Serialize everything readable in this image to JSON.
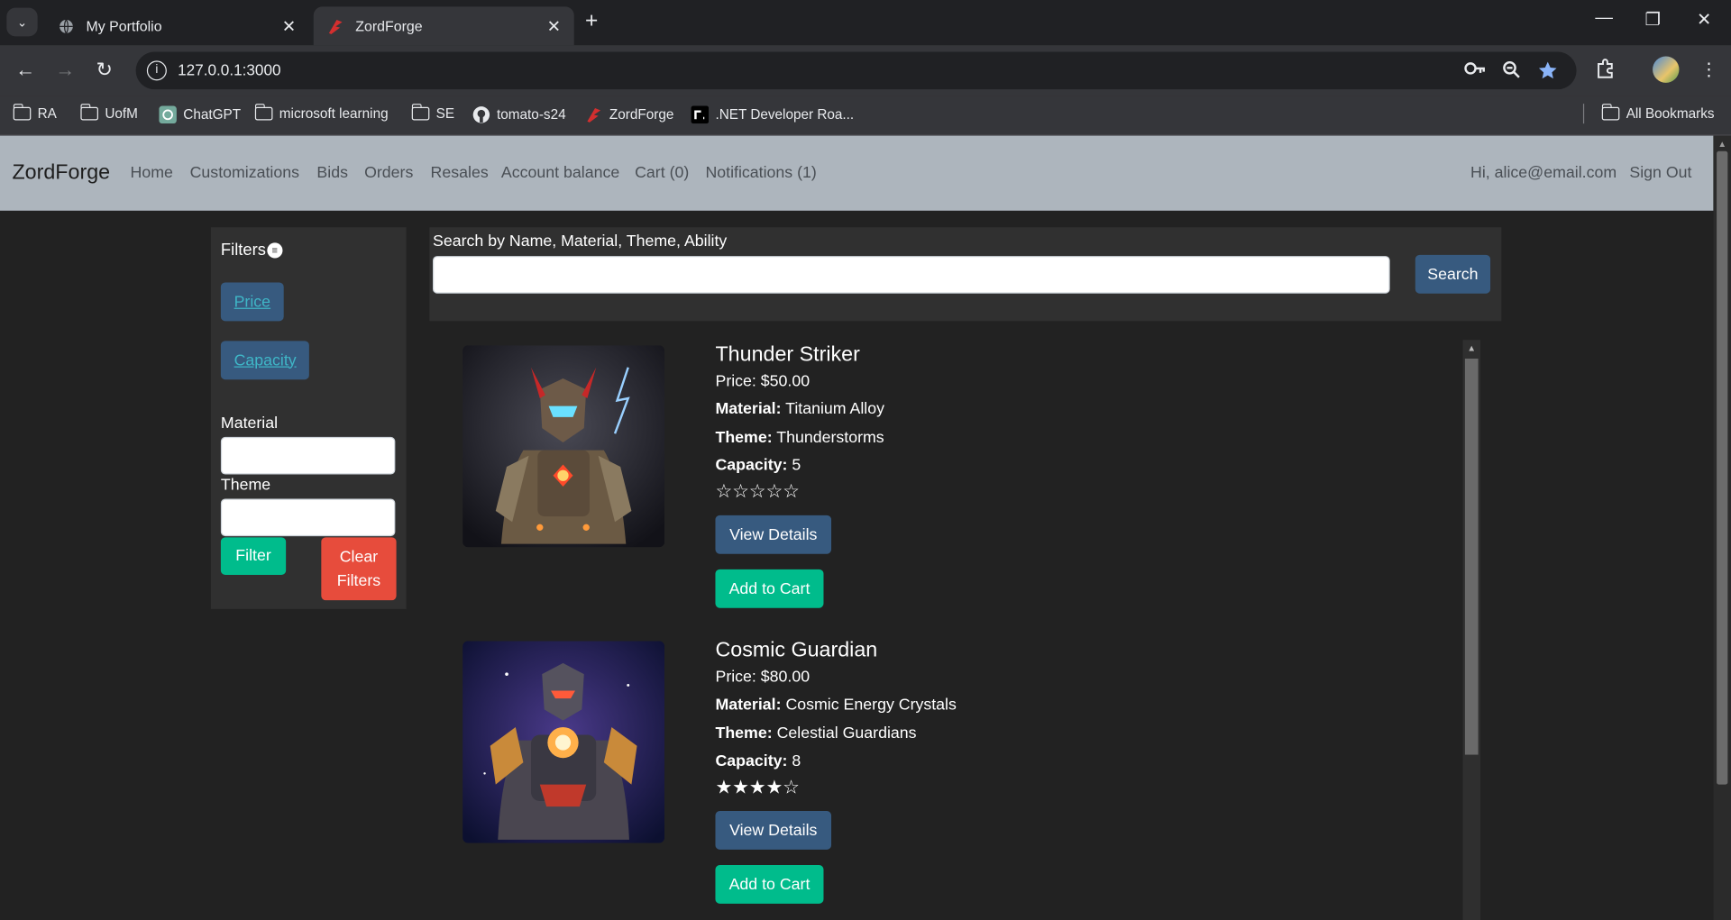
{
  "browser": {
    "tabs": [
      {
        "title": "My Portfolio",
        "icon": "globe-icon",
        "active": false
      },
      {
        "title": "ZordForge",
        "icon": "zordforge-logo-icon",
        "active": true
      }
    ],
    "url": "127.0.0.1:3000",
    "bookmarks": [
      {
        "label": "RA",
        "icon": "folder-icon"
      },
      {
        "label": "UofM",
        "icon": "folder-icon"
      },
      {
        "label": "ChatGPT",
        "icon": "chatgpt-icon"
      },
      {
        "label": "microsoft learning",
        "icon": "folder-icon"
      },
      {
        "label": "SE",
        "icon": "folder-icon"
      },
      {
        "label": "tomato-s24",
        "icon": "github-icon"
      },
      {
        "label": "ZordForge",
        "icon": "zordforge-logo-icon"
      },
      {
        "label": ".NET Developer Roa...",
        "icon": "roadmap-icon"
      }
    ],
    "all_bookmarks": "All Bookmarks"
  },
  "nav": {
    "brand": "ZordForge",
    "links": [
      "Home",
      "Customizations",
      "Bids",
      "Orders",
      "Resales",
      "Account balance",
      "Cart (0)",
      "Notifications (1)"
    ],
    "greeting": "Hi, alice@email.com",
    "signout": "Sign Out"
  },
  "filters": {
    "title": "Filters",
    "price": "Price",
    "capacity": "Capacity",
    "material_label": "Material",
    "material_value": "",
    "theme_label": "Theme",
    "theme_value": "",
    "filter_button": "Filter",
    "clear_line1": "Clear",
    "clear_line2": "Filters"
  },
  "search": {
    "label": "Search by Name, Material, Theme, Ability",
    "value": "",
    "button": "Search"
  },
  "labels": {
    "material": "Material:",
    "theme": "Theme:",
    "capacity": "Capacity:",
    "view_details": "View Details",
    "add_to_cart": "Add to Cart"
  },
  "products": [
    {
      "name": "Thunder Striker",
      "price": "Price: $50.00",
      "material": "Titanium Alloy",
      "theme": "Thunderstorms",
      "capacity": "5",
      "rating": 0,
      "rating_max": 5,
      "stars": "☆☆☆☆☆"
    },
    {
      "name": "Cosmic Guardian",
      "price": "Price: $80.00",
      "material": "Cosmic Energy Crystals",
      "theme": "Celestial Guardians",
      "capacity": "8",
      "rating": 4,
      "rating_max": 5,
      "stars": "★★★★☆"
    }
  ],
  "colors": {
    "navbar": "#adb5bd",
    "primary": "#375a7f",
    "success": "#00bc8c",
    "danger": "#e74c3c",
    "background": "#222222"
  }
}
